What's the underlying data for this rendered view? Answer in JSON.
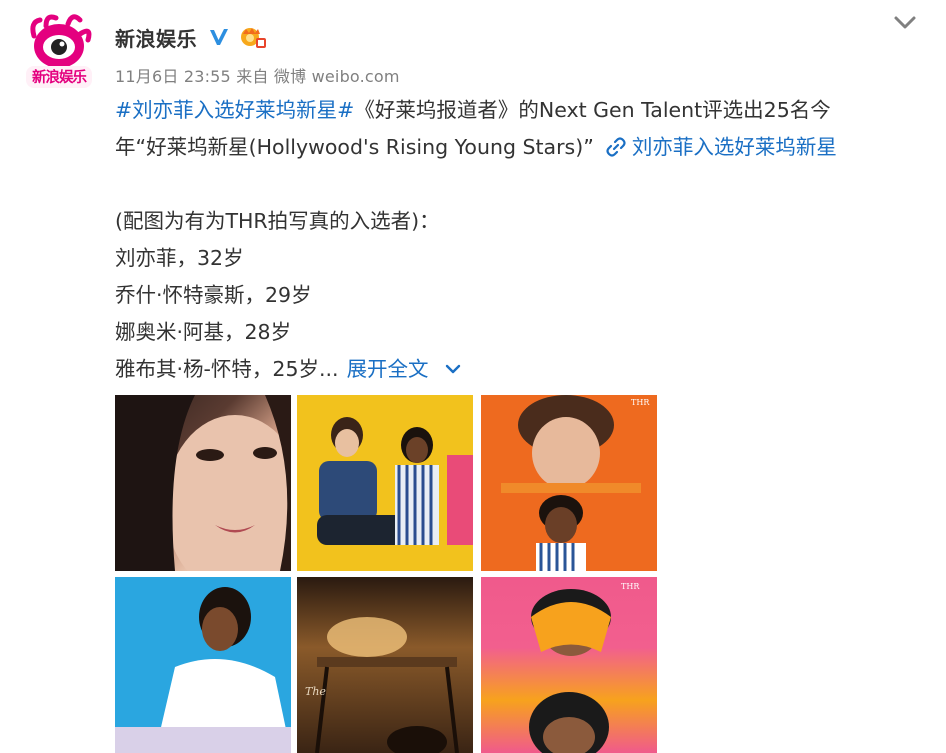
{
  "post": {
    "username": "新浪娱乐",
    "avatar_text": "新浪娱乐",
    "meta": "11月6日 23:55 来自 微博 weibo.com",
    "line1_hashtag": "#刘亦菲入选好莱坞新星#",
    "line1_text": "《好莱坞报道者》的Next Gen Talent评选出25名今",
    "line2_text": "年“好莱坞新星(Hollywood's Rising Young Stars)”",
    "line2_link": "刘亦菲入选好莱坞新星",
    "line4": "(配图为有为THR拍写真的入选者)：",
    "line5": "刘亦菲，32岁",
    "line6": "乔什·怀特豪斯，29岁",
    "line7": "娜奥米·阿基，28岁",
    "line8": "雅布其·杨-怀特，25岁...",
    "expand_label": "展开全文"
  },
  "images": [
    {
      "name": "photo-liu-yifei"
    },
    {
      "name": "photo-group-yellow"
    },
    {
      "name": "photo-orange-portraits"
    },
    {
      "name": "photo-blue-portrait"
    },
    {
      "name": "photo-studio-scene"
    },
    {
      "name": "photo-pink-portrait"
    }
  ],
  "colors": {
    "hashtag_blue": "#1a6fc4",
    "text": "#333333",
    "meta_gray": "#808080"
  }
}
